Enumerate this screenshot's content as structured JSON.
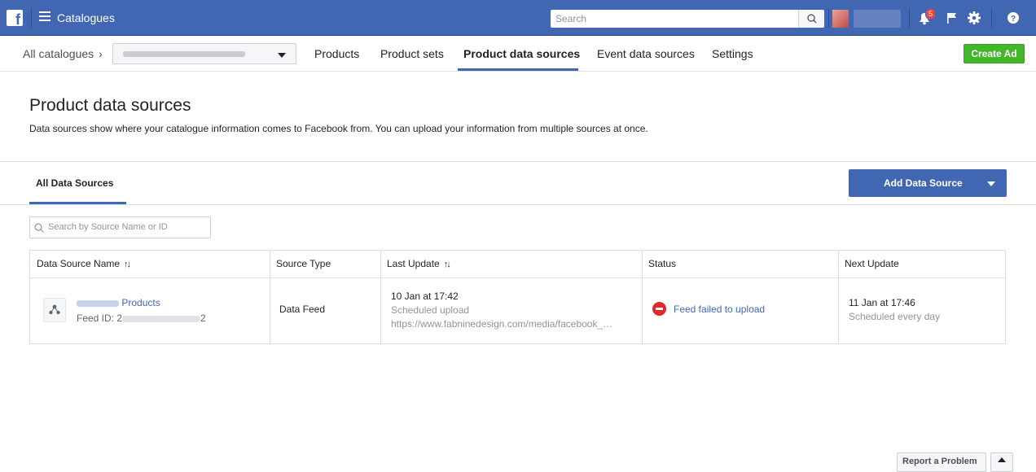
{
  "topbar": {
    "app_title": "Catalogues",
    "search_placeholder": "Search",
    "notification_count": "5"
  },
  "nav": {
    "breadcrumb": "All catalogues",
    "tabs": [
      "Products",
      "Product sets",
      "Product data sources",
      "Event data sources",
      "Settings"
    ],
    "active_tab": "Product data sources",
    "create_ad": "Create Ad"
  },
  "header": {
    "title": "Product data sources",
    "description": "Data sources show where your catalogue information comes to Facebook from. You can upload your information from multiple sources at once."
  },
  "sources": {
    "tab": "All Data Sources",
    "add_button": "Add Data Source",
    "search_placeholder": "Search by Source Name or ID"
  },
  "table": {
    "headers": [
      "Data Source Name",
      "Source Type",
      "Last Update",
      "Status",
      "Next Update"
    ],
    "rows": [
      {
        "name_suffix": "Products",
        "feed_id_prefix": "Feed ID: 2",
        "feed_id_suffix": "2",
        "source_type": "Data Feed",
        "last_update": "10 Jan at 17:42",
        "last_update_mode": "Scheduled upload",
        "last_update_url": "https://www.fabninedesign.com/media/facebook_…",
        "status": "Feed failed to upload",
        "next_update": "11 Jan at 17:46",
        "next_update_schedule": "Scheduled every day"
      }
    ]
  },
  "footer": {
    "report": "Report a Problem"
  },
  "colors": {
    "brand": "#4267b2",
    "create_ad": "#42b72a",
    "error": "#e02a2a"
  }
}
